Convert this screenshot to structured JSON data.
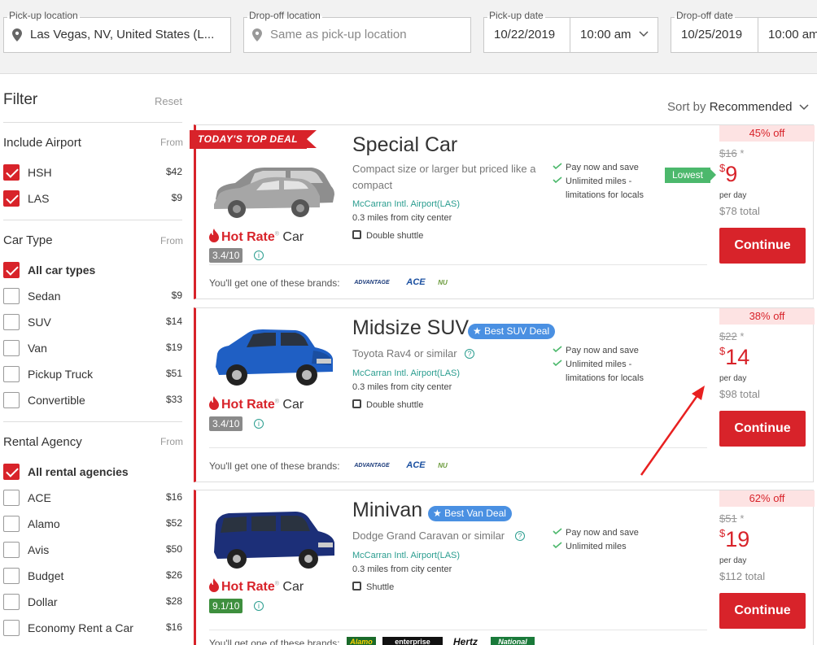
{
  "search": {
    "pickup_location": {
      "label": "Pick-up location",
      "value": "Las Vegas, NV, United States (L..."
    },
    "dropoff_location": {
      "label": "Drop-off location",
      "placeholder": "Same as pick-up location"
    },
    "pickup_date": {
      "label": "Pick-up date",
      "date": "10/22/2019",
      "time": "10:00 am"
    },
    "dropoff_date": {
      "label": "Drop-off date",
      "date": "10/25/2019",
      "time": "10:00 am"
    }
  },
  "filter": {
    "title": "Filter",
    "reset": "Reset",
    "airport": {
      "title": "Include Airport",
      "from": "From",
      "items": [
        {
          "name": "HSH",
          "price": "$42",
          "checked": true
        },
        {
          "name": "LAS",
          "price": "$9",
          "checked": true
        }
      ]
    },
    "car_type": {
      "title": "Car Type",
      "from": "From",
      "items": [
        {
          "name": "All car types",
          "price": "",
          "checked": true
        },
        {
          "name": "Sedan",
          "price": "$9",
          "checked": false
        },
        {
          "name": "SUV",
          "price": "$14",
          "checked": false
        },
        {
          "name": "Van",
          "price": "$19",
          "checked": false
        },
        {
          "name": "Pickup Truck",
          "price": "$51",
          "checked": false
        },
        {
          "name": "Convertible",
          "price": "$33",
          "checked": false
        }
      ]
    },
    "agency": {
      "title": "Rental Agency",
      "from": "From",
      "items": [
        {
          "name": "All rental agencies",
          "price": "",
          "checked": true
        },
        {
          "name": "ACE",
          "price": "$16",
          "checked": false
        },
        {
          "name": "Alamo",
          "price": "$52",
          "checked": false
        },
        {
          "name": "Avis",
          "price": "$50",
          "checked": false
        },
        {
          "name": "Budget",
          "price": "$26",
          "checked": false
        },
        {
          "name": "Dollar",
          "price": "$28",
          "checked": false
        },
        {
          "name": "Economy Rent a Car",
          "price": "$16",
          "checked": false
        }
      ]
    }
  },
  "sort": {
    "label": "Sort by",
    "value": "Recommended"
  },
  "cards": [
    {
      "ribbon": "TODAY'S TOP DEAL",
      "title": "Special Car",
      "subtitle": "Compact size or larger but priced like a compact",
      "airport": "McCarran Intl. Airport(LAS)",
      "distance": "0.3 miles from city center",
      "shuttle": "Double shuttle",
      "perks": [
        "Pay now and save",
        "Unlimited miles - limitations for locals"
      ],
      "hot_rate": "Hot Rate",
      "hot_car": "Car",
      "rating": "3.4/10",
      "brands_text": "You'll get one of these brands:",
      "brands": [
        "ADVANTAGE",
        "ACE",
        "NU"
      ],
      "off": "45% off",
      "old_price": "$16",
      "asterisk": "*",
      "currency": "$",
      "price": "9",
      "per_day": "per day",
      "total": "$78 total",
      "continue": "Continue",
      "lowest": "Lowest"
    },
    {
      "title": "Midsize SUV",
      "badge": "Best SUV Deal",
      "subtitle": "Toyota Rav4 or similar",
      "airport": "McCarran Intl. Airport(LAS)",
      "distance": "0.3 miles from city center",
      "shuttle": "Double shuttle",
      "perks": [
        "Pay now and save",
        "Unlimited miles - limitations for locals"
      ],
      "hot_rate": "Hot Rate",
      "hot_car": "Car",
      "rating": "3.4/10",
      "brands_text": "You'll get one of these brands:",
      "brands": [
        "ADVANTAGE",
        "ACE",
        "NU"
      ],
      "off": "38% off",
      "old_price": "$22",
      "asterisk": "*",
      "currency": "$",
      "price": "14",
      "per_day": "per day",
      "total": "$98 total",
      "continue": "Continue"
    },
    {
      "title": "Minivan",
      "badge": "Best Van Deal",
      "subtitle": "Dodge Grand Caravan or similar",
      "airport": "McCarran Intl. Airport(LAS)",
      "distance": "0.3 miles from city center",
      "shuttle": "Shuttle",
      "perks": [
        "Pay now and save",
        "Unlimited miles"
      ],
      "hot_rate": "Hot Rate",
      "hot_car": "Car",
      "rating": "9.1/10",
      "brands_text": "You'll get one of these brands:",
      "brands": [
        "Alamo",
        "enterprise",
        "Hertz",
        "National"
      ],
      "off": "62% off",
      "old_price": "$51",
      "asterisk": "*",
      "currency": "$",
      "price": "19",
      "per_day": "per day",
      "total": "$112 total",
      "continue": "Continue"
    }
  ],
  "colors": {
    "accent": "#d8232a",
    "badge": "#4a90e2",
    "lowest": "#4cb86c",
    "link": "#2a9d8f"
  }
}
